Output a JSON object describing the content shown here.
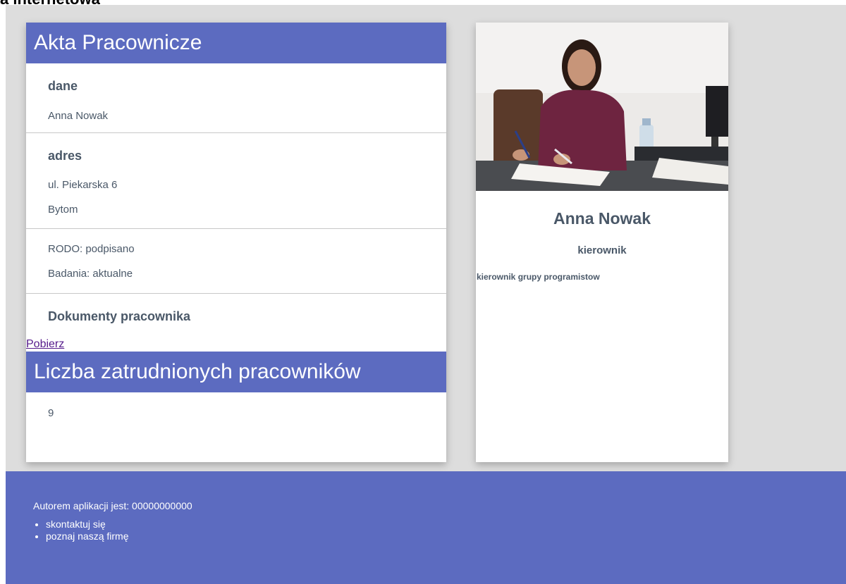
{
  "page": {
    "top_title": "a internetowa"
  },
  "employee_card": {
    "header": "Akta Pracownicze",
    "data_section": {
      "title": "dane",
      "name": "Anna Nowak"
    },
    "address_section": {
      "title": "adres",
      "street": "ul. Piekarska 6",
      "city": "Bytom"
    },
    "status_section": {
      "rodo": "RODO: podpisano",
      "medical": "Badania: aktualne"
    },
    "documents_section": {
      "title": "Dokumenty pracownika",
      "download_label": "Pobierz"
    },
    "count_header": "Liczba zatrudnionych pracowników",
    "count_value": "9"
  },
  "profile_card": {
    "name": "Anna Nowak",
    "role": "kierownik",
    "description": "kierownik grupy programistow"
  },
  "footer": {
    "author": "Autorem aplikacji jest: 00000000000",
    "links": [
      {
        "label": "skontaktuj się"
      },
      {
        "label": "poznaj naszą firmę"
      }
    ]
  },
  "colors": {
    "accent": "#5c6bc0",
    "background": "#dddddd",
    "text": "#4a5868",
    "link_visited": "#551a8b"
  }
}
